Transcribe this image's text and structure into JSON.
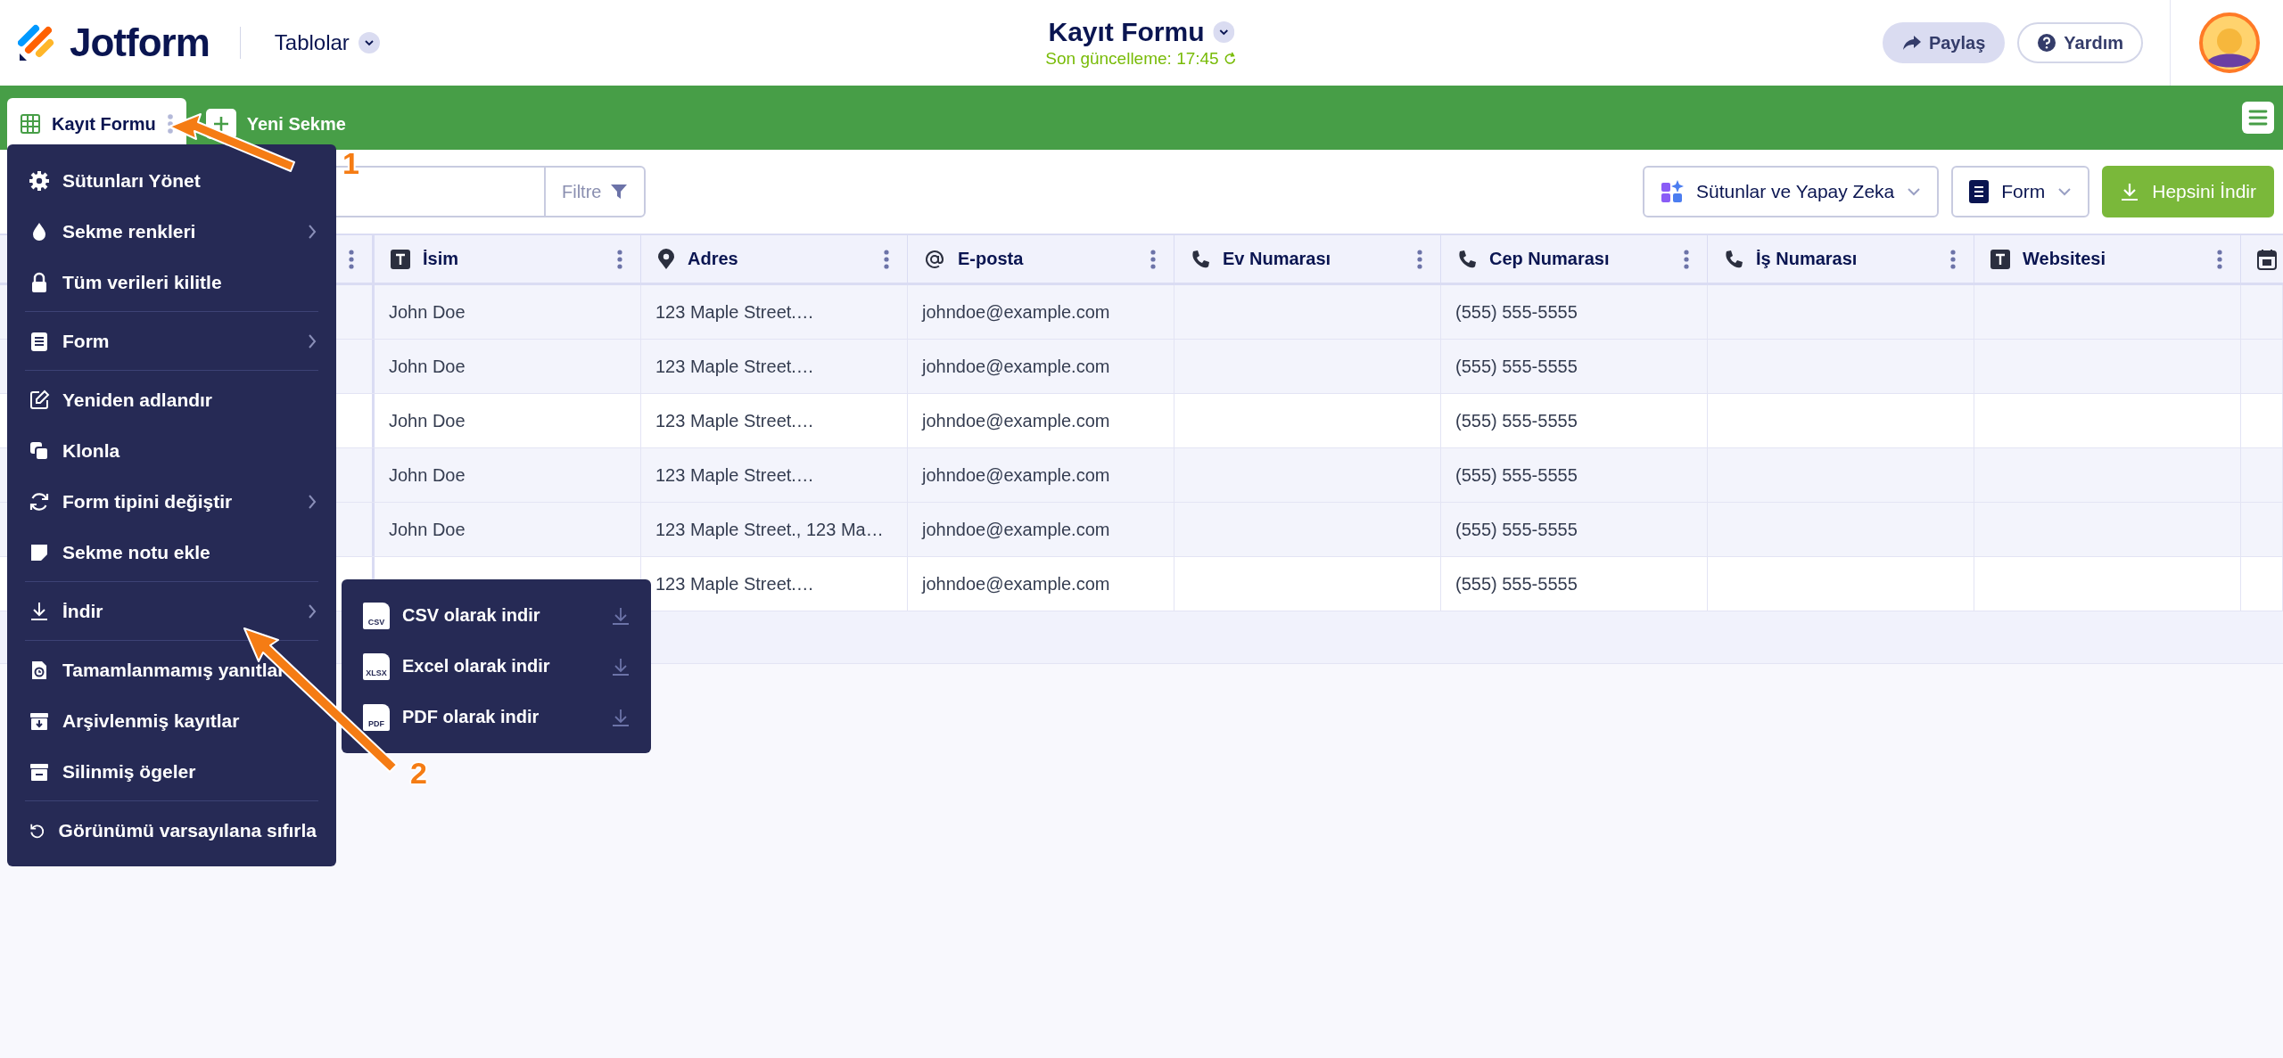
{
  "header": {
    "logo": "Jotform",
    "section": "Tablolar",
    "title": "Kayıt Formu",
    "subtitle": "Son güncelleme: 17:45",
    "buttons": [
      {
        "label": "Paylaş",
        "kind": "share"
      },
      {
        "label": "Yardım",
        "kind": "help"
      }
    ]
  },
  "tabs": [
    {
      "label": "Kayıt Formu",
      "kind": "sheet",
      "selected": true
    },
    {
      "label": "Yeni Sekme",
      "kind": "add",
      "selected": false
    }
  ],
  "toolbar": {
    "filter": "Filtre",
    "buttons": [
      {
        "label": "Sütunlar ve Yapay Zeka",
        "kind": "ai"
      },
      {
        "label": "Form",
        "kind": "form"
      },
      {
        "label": "Hepsini İndir",
        "kind": "download"
      }
    ]
  },
  "table": {
    "columns": [
      {
        "kind": "hidden"
      },
      {
        "label": "İsim",
        "kind": "text"
      },
      {
        "label": "Adres",
        "kind": "address"
      },
      {
        "label": "E-posta",
        "kind": "email"
      },
      {
        "label": "Ev Numarası",
        "kind": "phone"
      },
      {
        "label": "Cep Numarası",
        "kind": "phone"
      },
      {
        "label": "İş Numarası",
        "kind": "phone"
      },
      {
        "label": "Websitesi",
        "kind": "text"
      },
      {
        "kind": "date"
      }
    ],
    "rows": [
      {
        "shaded": true,
        "cells": [
          null,
          "John Doe",
          "123 Maple Street.…",
          "johndoe@example.com",
          null,
          "(555) 555-5555",
          null,
          null,
          null
        ]
      },
      {
        "shaded": true,
        "cells": [
          null,
          "John Doe",
          "123 Maple Street.…",
          "johndoe@example.com",
          null,
          "(555) 555-5555",
          null,
          null,
          null
        ]
      },
      {
        "shaded": false,
        "cells": [
          null,
          "John Doe",
          "123 Maple Street.…",
          "johndoe@example.com",
          null,
          "(555) 555-5555",
          null,
          null,
          null
        ]
      },
      {
        "shaded": true,
        "cells": [
          null,
          "John Doe",
          "123 Maple Street.…",
          "johndoe@example.com",
          null,
          "(555) 555-5555",
          null,
          null,
          null
        ]
      },
      {
        "shaded": true,
        "cells": [
          null,
          "John Doe",
          "123 Maple Street., 123 Ma…",
          "johndoe@example.com",
          null,
          "(555) 555-5555",
          null,
          null,
          null
        ]
      },
      {
        "shaded": false,
        "cells": [
          null,
          null,
          "123 Maple Street.…",
          "johndoe@example.com",
          null,
          "(555) 555-5555",
          null,
          null,
          null
        ]
      }
    ]
  },
  "menu": [
    [
      {
        "label": "Sütunları Yönet",
        "kind": "columns",
        "submenu": false
      },
      {
        "label": "Sekme renkleri",
        "kind": "colors",
        "submenu": true
      },
      {
        "label": "Tüm verileri kilitle",
        "kind": "lock",
        "submenu": false
      }
    ],
    [
      {
        "label": "Form",
        "kind": "form",
        "submenu": true
      }
    ],
    [
      {
        "label": "Yeniden adlandır",
        "kind": "rename",
        "submenu": false
      },
      {
        "label": "Klonla",
        "kind": "clone",
        "submenu": false
      },
      {
        "label": "Form tipini değiştir",
        "kind": "change",
        "submenu": true
      },
      {
        "label": "Sekme notu ekle",
        "kind": "note",
        "submenu": false
      }
    ],
    [
      {
        "label": "İndir",
        "kind": "download",
        "submenu": true
      }
    ],
    [
      {
        "label": "Tamamlanmamış yanıtlar",
        "kind": "incomplete",
        "submenu": false
      },
      {
        "label": "Arşivlenmiş kayıtlar",
        "kind": "archive",
        "submenu": false
      },
      {
        "label": "Silinmiş ögeler",
        "kind": "trash",
        "submenu": false
      }
    ],
    [
      {
        "label": "Görünümü varsayılana sıfırla",
        "kind": "reset",
        "submenu": false
      }
    ]
  ],
  "submenu": [
    {
      "label": "CSV olarak indir",
      "badge": "CSV"
    },
    {
      "label": "Excel olarak indir",
      "badge": "XLSX"
    },
    {
      "label": "PDF olarak indir",
      "badge": "PDF"
    }
  ],
  "annotations": [
    {
      "label": "1"
    },
    {
      "label": "2"
    }
  ]
}
